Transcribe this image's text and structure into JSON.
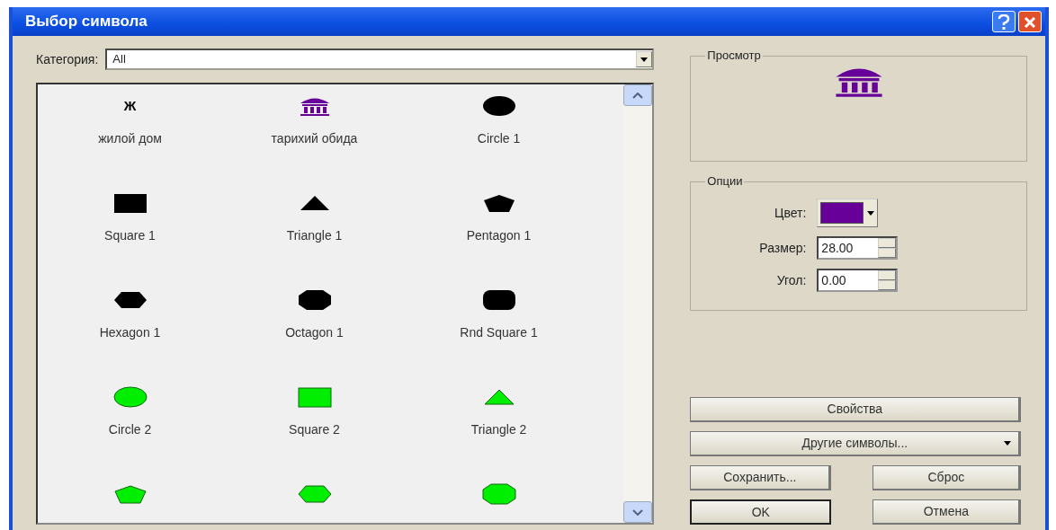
{
  "window": {
    "title": "Выбор символа"
  },
  "category": {
    "label": "Категория:",
    "value": "All"
  },
  "symbols": [
    {
      "label": "жилой дом",
      "kind": "glyph",
      "glyph": "Ж",
      "color": "#000000"
    },
    {
      "label": "тарихий обида",
      "kind": "building",
      "color": "#660099"
    },
    {
      "label": "Circle 1",
      "kind": "circle",
      "color": "#000000"
    },
    {
      "label": "Square 1",
      "kind": "square",
      "color": "#000000"
    },
    {
      "label": "Triangle 1",
      "kind": "triangle",
      "color": "#000000"
    },
    {
      "label": "Pentagon 1",
      "kind": "pentagon",
      "color": "#000000"
    },
    {
      "label": "Hexagon 1",
      "kind": "hexagon",
      "color": "#000000"
    },
    {
      "label": "Octagon 1",
      "kind": "octagon",
      "color": "#000000"
    },
    {
      "label": "Rnd Square 1",
      "kind": "rounded_square",
      "color": "#000000"
    },
    {
      "label": "Circle 2",
      "kind": "circle",
      "color": "#00ee00"
    },
    {
      "label": "Square 2",
      "kind": "square",
      "color": "#00ee00"
    },
    {
      "label": "Triangle 2",
      "kind": "triangle",
      "color": "#00ee00"
    },
    {
      "kind": "pentagon",
      "color": "#00ee00"
    },
    {
      "kind": "hexagon",
      "color": "#00ee00"
    },
    {
      "kind": "octagon",
      "color": "#00ee00"
    }
  ],
  "preview": {
    "title": "Просмотр",
    "kind": "building",
    "color": "#660099"
  },
  "options": {
    "title": "Опции",
    "color_label": "Цвет:",
    "color": "#660099",
    "size_label": "Размер:",
    "size": "28.00",
    "angle_label": "Угол:",
    "angle": "0.00"
  },
  "buttons": {
    "properties": "Свойства",
    "more_symbols": "Другие символы...",
    "save": "Сохранить...",
    "reset": "Сброс",
    "ok": "OK",
    "cancel": "Отмена"
  }
}
